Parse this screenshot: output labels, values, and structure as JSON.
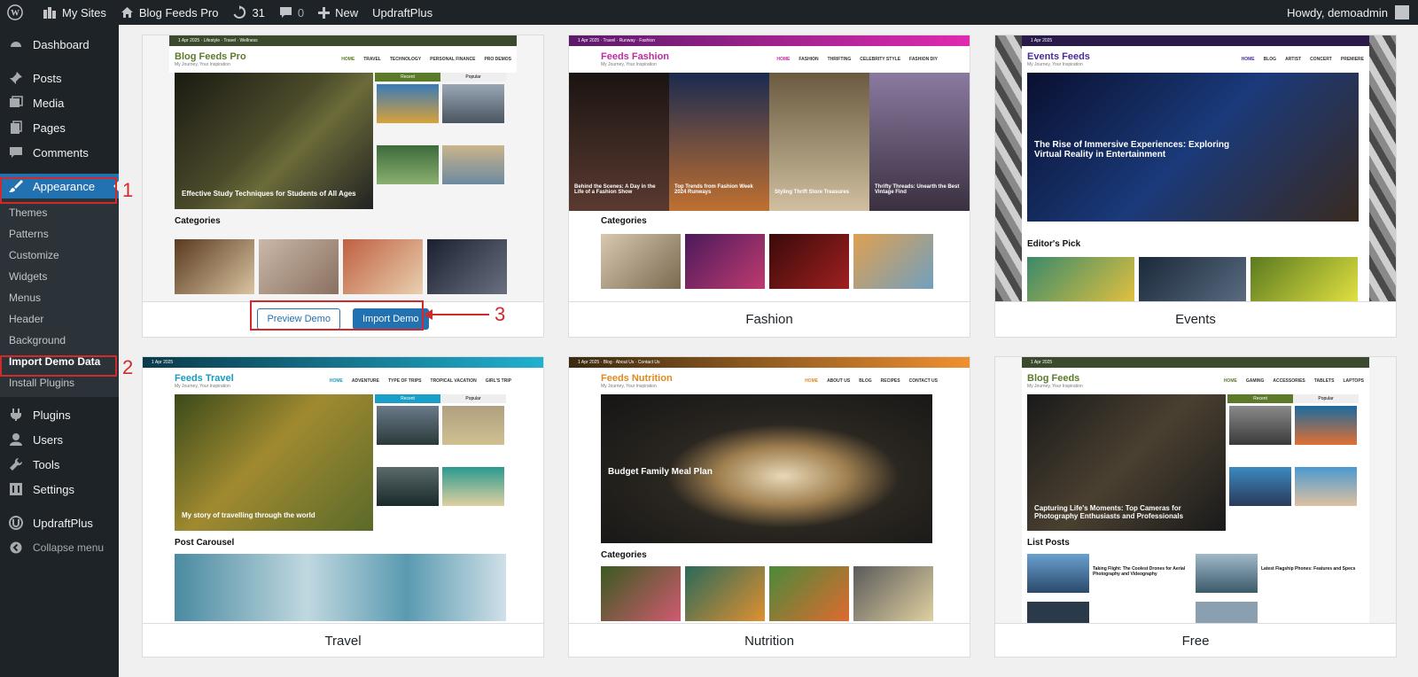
{
  "adminbar": {
    "my_sites": "My Sites",
    "site_name": "Blog Feeds Pro",
    "updates_count": "31",
    "comments_count": "0",
    "new_label": "New",
    "updraft": "UpdraftPlus",
    "howdy": "Howdy, demoadmin"
  },
  "sidebar": {
    "dashboard": "Dashboard",
    "posts": "Posts",
    "media": "Media",
    "pages": "Pages",
    "comments": "Comments",
    "appearance": "Appearance",
    "sub": [
      "Themes",
      "Patterns",
      "Customize",
      "Widgets",
      "Menus",
      "Header",
      "Background",
      "Import Demo Data",
      "Install Plugins"
    ],
    "plugins": "Plugins",
    "users": "Users",
    "tools": "Tools",
    "settings": "Settings",
    "updraftplus": "UpdraftPlus",
    "collapse": "Collapse menu"
  },
  "annotations": {
    "one": "1",
    "two": "2",
    "three": "3"
  },
  "cards": {
    "c1": {
      "logo": "Blog Feeds Pro",
      "tag": "My Journey, Your Inspiration",
      "nav": [
        "HOME",
        "TRAVEL",
        "TECHNOLOGY",
        "PERSONAL FINANCE",
        "PRO DEMOS"
      ],
      "hero": "Effective Study Techniques for Students of All Ages",
      "tab1": "Recent",
      "tab2": "Popular",
      "categories": "Categories",
      "preview": "Preview Demo",
      "import": "Import Demo"
    },
    "c2": {
      "logo": "Feeds Fashion",
      "tag": "My Journey, Your Inspiration",
      "nav": [
        "HOME",
        "FASHION",
        "THRIFTING",
        "CELEBRITY STYLE",
        "FASHION DIY"
      ],
      "s1": "Behind the Scenes: A Day in the Life of a Fashion Show",
      "s2": "Top Trends from Fashion Week 2024 Runways",
      "s3": "Styling Thrift Store Treasures",
      "s4": "Thrifty Threads: Unearth the Best Vintage Find",
      "categories": "Categories",
      "label": "Fashion"
    },
    "c3": {
      "logo": "Events Feeds",
      "tag": "My Journey, Your Inspiration",
      "nav": [
        "HOME",
        "BLOG",
        "ARTIST",
        "CONCERT",
        "PREMIERE"
      ],
      "hero": "The Rise of Immersive Experiences: Exploring Virtual Reality in Entertainment",
      "editors": "Editor's Pick",
      "label": "Events"
    },
    "c4": {
      "logo": "Feeds Travel",
      "tag": "My Journey, Your Inspiration",
      "nav": [
        "HOME",
        "ADVENTURE",
        "TYPE OF TRIPS",
        "TROPICAL VACATION",
        "GIRL'S TRIP"
      ],
      "hero": "My story of travelling through the world",
      "tab1": "Recent",
      "tab2": "Popular",
      "carousel": "Post Carousel",
      "label": "Travel"
    },
    "c5": {
      "logo": "Feeds Nutrition",
      "tag": "My Journey, Your Inspiration",
      "nav": [
        "HOME",
        "ABOUT US",
        "BLOG",
        "RECIPES",
        "CONTACT US"
      ],
      "hero": "Budget Family Meal Plan",
      "categories": "Categories",
      "label": "Nutrition"
    },
    "c6": {
      "logo": "Blog Feeds",
      "tag": "My Journey, Your Inspiration",
      "nav": [
        "HOME",
        "GAMING",
        "ACCESSORIES",
        "TABLETS",
        "LAPTOPS"
      ],
      "hero": "Capturing Life's Moments: Top Cameras for Photography Enthusiasts and Professionals",
      "tab1": "Recent",
      "tab2": "Popular",
      "list": "List Posts",
      "l1": "Taking Flight: The Coolest Drones for Aerial Photography and Videography",
      "l2": "Latest Flagship Phones: Features and Specs",
      "label": "Free"
    }
  },
  "colors": {
    "accent": "#2271b1",
    "admin_bg": "#1d2327",
    "annotation": "#d12a2a"
  }
}
